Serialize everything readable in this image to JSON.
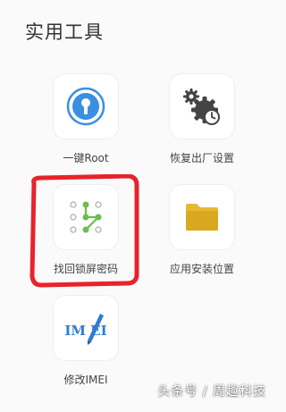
{
  "section_title": "实用工具",
  "tools": [
    {
      "label": "一键Root",
      "icon": "key-shield-icon"
    },
    {
      "label": "恢复出厂设置",
      "icon": "gears-clock-icon"
    },
    {
      "label": "找回锁屏密码",
      "icon": "pattern-lock-icon"
    },
    {
      "label": "应用安装位置",
      "icon": "folder-icon"
    },
    {
      "label": "修改IMEI",
      "icon": "imei-pen-icon",
      "icon_text": "IM  EI"
    }
  ],
  "watermark": "头条号 / 周趣科技",
  "colors": {
    "root_blue": "#3a8fe0",
    "gear_dark": "#444444",
    "pattern_green": "#6abf4b",
    "folder_yellow": "#e6b833",
    "imei_blue": "#2f7bd3",
    "annotation_red": "#e8232b"
  }
}
